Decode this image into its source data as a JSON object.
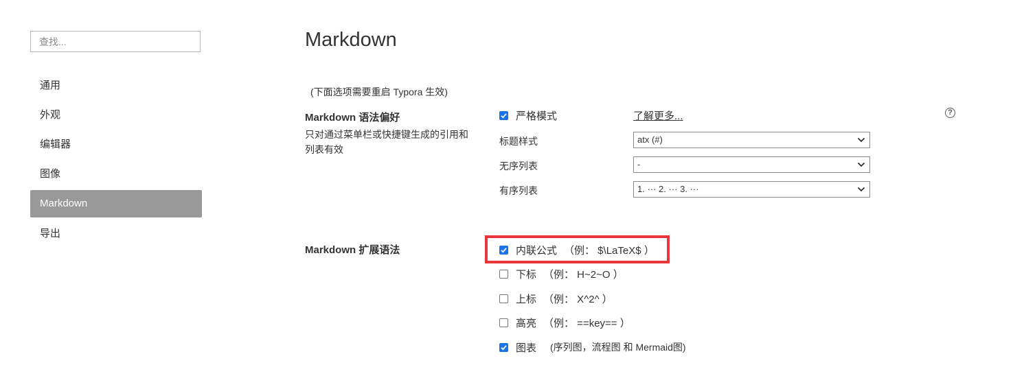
{
  "search": {
    "placeholder": "查找..."
  },
  "sidebar": {
    "items": [
      {
        "label": "通用"
      },
      {
        "label": "外观"
      },
      {
        "label": "编辑器"
      },
      {
        "label": "图像"
      },
      {
        "label": "Markdown",
        "active": true
      },
      {
        "label": "导出"
      }
    ]
  },
  "page": {
    "title": "Markdown",
    "restart_note": "(下面选项需要重启 Typora 生效)"
  },
  "syntax_pref": {
    "title": "Markdown 语法偏好",
    "description": "只对通过菜单栏或快捷键生成的引用和列表有效",
    "strict_mode": {
      "label": "严格模式",
      "checked": true
    },
    "learn_more": "了解更多...",
    "heading_style": {
      "label": "标题样式",
      "value": "atx (#)"
    },
    "unordered_list": {
      "label": "无序列表",
      "value": "-"
    },
    "ordered_list": {
      "label": "有序列表",
      "value": "1. ··· 2. ··· 3. ···"
    }
  },
  "extensions": {
    "title": "Markdown 扩展语法",
    "items": [
      {
        "label": "内联公式",
        "example": "（例： $\\LaTeX$ ）",
        "checked": true
      },
      {
        "label": "下标",
        "example": "（例： H~2~O ）",
        "checked": false
      },
      {
        "label": "上标",
        "example": "（例： X^2^ ）",
        "checked": false
      },
      {
        "label": "高亮",
        "example": "（例： ==key== ）",
        "checked": false
      },
      {
        "label": "图表",
        "example": "(序列图，流程图 和 Mermaid图)",
        "checked": true
      }
    ]
  },
  "colors": {
    "accent": "#1a73e8",
    "active_nav": "#999999",
    "highlight_border": "#e8363a"
  },
  "icons": {
    "help": "help-circle-icon",
    "dropdown": "chevron-down-icon",
    "check": "check-icon"
  }
}
